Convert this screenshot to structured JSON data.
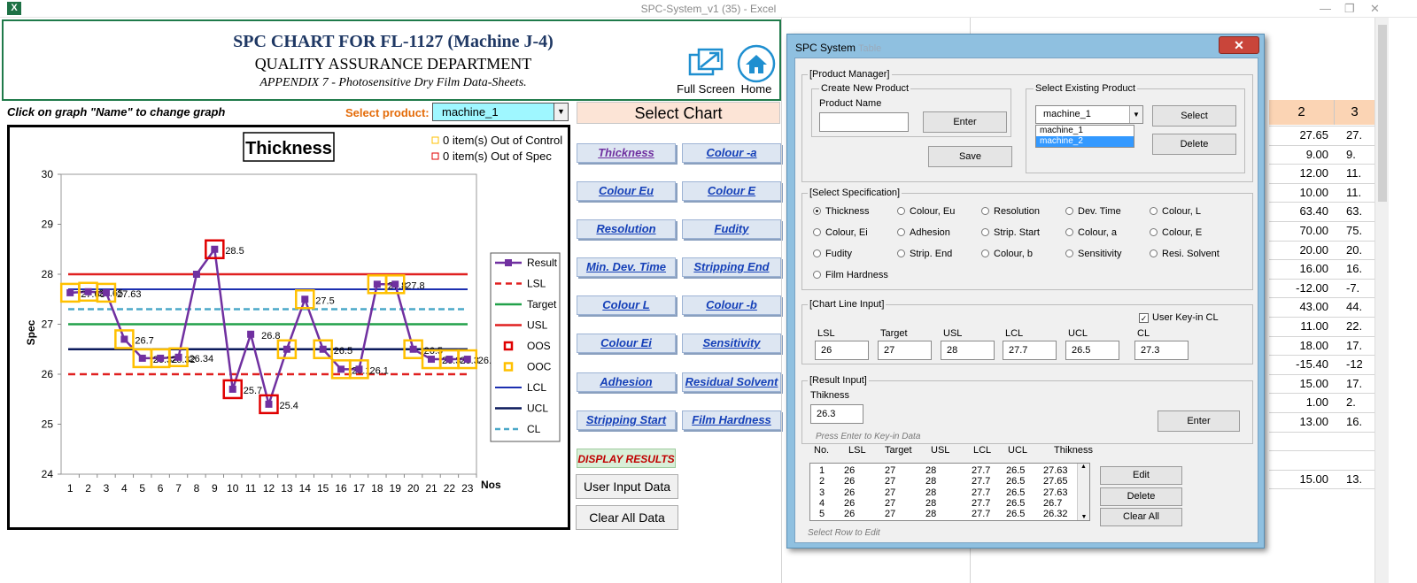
{
  "window": {
    "title": "SPC-System_v1 (35) - Excel",
    "app_icon": "X"
  },
  "header": {
    "title": "SPC CHART FOR FL-1127 (Machine J-4)",
    "subtitle": "QUALITY ASSURANCE DEPARTMENT",
    "appendix": "APPENDIX 7 - Photosensitive Dry Film Data-Sheets.",
    "full_screen_label": "Full Screen",
    "home_label": "Home"
  },
  "instruction": "Click on graph \"Name\" to change graph",
  "product_select": {
    "label": "Select product:",
    "value": "machine_1"
  },
  "chart_selector": {
    "title": "Select Chart",
    "buttons": [
      "Thickness",
      "Colour -a",
      "Colour Eu",
      "Colour E",
      "Resolution",
      "Fudity",
      "Min. Dev. Time",
      "Stripping End",
      "Colour L",
      "Colour -b",
      "Colour Ei",
      "Sensitivity",
      "Adhesion",
      "Residual Solvent",
      "Stripping Start",
      "Film Hardness"
    ],
    "display_results": "DISPLAY RESULTS",
    "user_input": "User Input Data",
    "clear_all": "Clear All Data"
  },
  "chart_data": {
    "type": "line",
    "title": "Thickness",
    "status_ooc": "0 item(s) Out of Control",
    "status_oos": "0 item(s) Out of Spec",
    "xlabel": "Nos",
    "ylabel": "Spec",
    "ylim": [
      24,
      30
    ],
    "yticks": [
      "24",
      "25",
      "26",
      "27",
      "28",
      "29",
      "30"
    ],
    "x": [
      1,
      2,
      3,
      4,
      5,
      6,
      7,
      8,
      9,
      10,
      11,
      12,
      13,
      14,
      15,
      16,
      17,
      18,
      19,
      20,
      21,
      22,
      23
    ],
    "series": [
      {
        "name": "Result",
        "values": [
          27.63,
          27.65,
          27.63,
          26.7,
          26.32,
          26.32,
          26.34,
          28.0,
          28.5,
          25.7,
          26.8,
          25.4,
          26.5,
          27.5,
          26.5,
          26.1,
          26.1,
          27.8,
          27.8,
          26.5,
          26.3,
          26.3,
          26.3
        ]
      }
    ],
    "data_labels": [
      "27.63",
      "27.65",
      "27.63",
      "26.7",
      "26.32",
      "26.32",
      "26.34",
      "",
      "28.5",
      "25.7",
      "26.8",
      "25.4",
      "",
      "27.5",
      "26.5",
      "26.1",
      "26.1",
      "27.8",
      "27.8",
      "26.5",
      "26.3",
      "26.3",
      "26.3"
    ],
    "lines": {
      "LSL": 26,
      "Target": 27,
      "USL": 28,
      "LCL": 27.7,
      "UCL": 26.5,
      "CL": 27.3
    },
    "legend": [
      "Result",
      "LSL",
      "Target",
      "USL",
      "OOS",
      "OOC",
      "LCL",
      "UCL",
      "CL"
    ],
    "legend_position": "right",
    "colors": {
      "result": "#7030a0",
      "lsl": "#e02020",
      "target": "#22a14a",
      "usl": "#e02020",
      "oos": "#e00000",
      "ooc": "#ffc000",
      "lcl": "#1c2fb0",
      "ucl": "#0b1a5c",
      "cl": "#4ba8c8"
    },
    "oos_points": [
      9,
      10,
      12
    ],
    "ooc_points": [
      1,
      2,
      3,
      4,
      5,
      6,
      7,
      13,
      14,
      15,
      16,
      17,
      18,
      19,
      20,
      21,
      22,
      23
    ]
  },
  "sheet": {
    "headers": [
      "2",
      "3"
    ],
    "col2": [
      "27.65",
      "9.00",
      "12.00",
      "10.00",
      "63.40",
      "70.00",
      "20.00",
      "16.00",
      "-12.00",
      "43.00",
      "11.00",
      "18.00",
      "-15.40",
      "15.00",
      "1.00",
      "13.00",
      "",
      "",
      "15.00"
    ],
    "col3": [
      "27.",
      "9.",
      "11.",
      "11.",
      "63.",
      "75.",
      "20.",
      "16.",
      "-7.",
      "44.",
      "22.",
      "17.",
      "-12",
      "17.",
      "2.",
      "16.",
      "",
      "",
      "13."
    ]
  },
  "dialog": {
    "title": "SPC System",
    "behind_text": "Table",
    "close": "✕",
    "product_manager": {
      "group": "[Product Manager]",
      "create_group": "Create New Product",
      "name_label": "Product Name",
      "name_value": "",
      "enter": "Enter",
      "save": "Save",
      "select_group": "Select Existing Product",
      "selected": "machine_1",
      "options": [
        "machine_1",
        "machine_2"
      ],
      "select_btn": "Select",
      "delete_btn": "Delete"
    },
    "spec": {
      "group": "[Select Specification]",
      "options": [
        "Thickness",
        "Colour, Eu",
        "Resolution",
        "Dev. Time",
        "Colour, L",
        "Colour, Ei",
        "Adhesion",
        "Strip. Start",
        "Colour, a",
        "Colour, E",
        "Fudity",
        "Strip. End",
        "Colour, b",
        "Sensitivity",
        "Resi. Solvent",
        "Film Hardness"
      ],
      "selected": "Thickness"
    },
    "chart_line": {
      "group": "[Chart Line Input]",
      "user_key": "User Key-in CL",
      "labels": [
        "LSL",
        "Target",
        "USL",
        "LCL",
        "UCL",
        "CL"
      ],
      "values": [
        "26",
        "27",
        "28",
        "27.7",
        "26.5",
        "27.3"
      ]
    },
    "result": {
      "group": "[Result Input]",
      "label": "Thikness",
      "value": "26.3",
      "enter": "Enter",
      "hint": "Press Enter to Key-in Data"
    },
    "table": {
      "headers": [
        "No.",
        "LSL",
        "Target",
        "USL",
        "LCL",
        "UCL",
        "Thikness"
      ],
      "rows": [
        [
          "1",
          "26",
          "27",
          "28",
          "27.7",
          "26.5",
          "27.63"
        ],
        [
          "2",
          "26",
          "27",
          "28",
          "27.7",
          "26.5",
          "27.65"
        ],
        [
          "3",
          "26",
          "27",
          "28",
          "27.7",
          "26.5",
          "27.63"
        ],
        [
          "4",
          "26",
          "27",
          "28",
          "27.7",
          "26.5",
          "26.7"
        ],
        [
          "5",
          "26",
          "27",
          "28",
          "27.7",
          "26.5",
          "26.32"
        ]
      ],
      "edit": "Edit",
      "delete": "Delete",
      "clear": "Clear All",
      "hint": "Select Row to Edit"
    }
  }
}
